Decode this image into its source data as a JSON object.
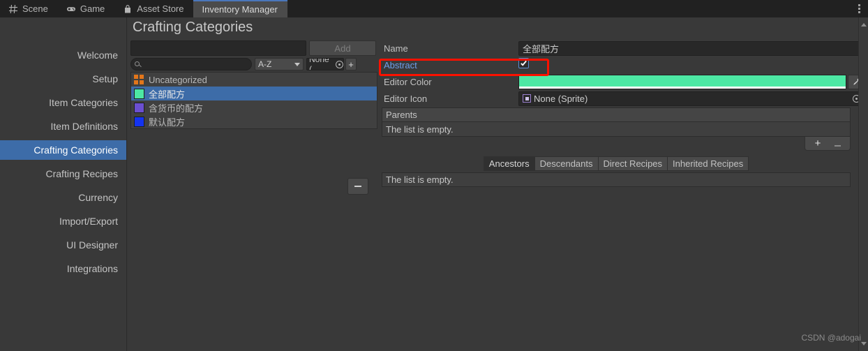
{
  "window": {
    "tabs": [
      {
        "label": "Scene",
        "icon": "grid-icon",
        "active": false
      },
      {
        "label": "Game",
        "icon": "gamepad-icon",
        "active": false
      },
      {
        "label": "Asset Store",
        "icon": "shopping-bag-icon",
        "active": false
      },
      {
        "label": "Inventory Manager",
        "icon": "none",
        "active": true
      }
    ],
    "menu_icon": "kebab-menu-icon"
  },
  "sidebar": {
    "items": [
      {
        "label": "Welcome",
        "active": false
      },
      {
        "label": "Setup",
        "active": false
      },
      {
        "label": "Item Categories",
        "active": false
      },
      {
        "label": "Item Definitions",
        "active": false
      },
      {
        "label": "Crafting Categories",
        "active": true
      },
      {
        "label": "Crafting Recipes",
        "active": false
      },
      {
        "label": "Currency",
        "active": false
      },
      {
        "label": "Import/Export",
        "active": false
      },
      {
        "label": "UI Designer",
        "active": false
      },
      {
        "label": "Integrations",
        "active": false
      }
    ]
  },
  "main": {
    "title": "Crafting Categories",
    "toolbar": {
      "new_name_value": "",
      "new_name_placeholder": "",
      "add_label": "Add",
      "search_value": "",
      "search_placeholder": "",
      "sort_value": "A-Z",
      "filter_value": "None (",
      "plus_label": "+"
    },
    "list": {
      "items": [
        {
          "label": "Uncategorized",
          "swatch": "#e2761b",
          "swatch_kind": "grid4",
          "selected": false
        },
        {
          "label": "全部配方",
          "swatch": "#4de8a4",
          "swatch_kind": "solid",
          "selected": true
        },
        {
          "label": "含货币的配方",
          "swatch": "#6b4fd0",
          "swatch_kind": "solid",
          "selected": false
        },
        {
          "label": "默认配方",
          "swatch": "#1433f0",
          "swatch_kind": "solid",
          "selected": false
        }
      ],
      "remove_label": "–"
    }
  },
  "inspector": {
    "fields": [
      {
        "label": "Name",
        "type": "text",
        "value": "全部配方"
      },
      {
        "label": "Abstract",
        "type": "checkbox",
        "value": "checked",
        "highlighted": true
      },
      {
        "label": "Editor Color",
        "type": "color",
        "value": "#4de8a4"
      },
      {
        "label": "Editor Icon",
        "type": "object",
        "value": "None (Sprite)"
      }
    ],
    "parents": {
      "header": "Parents",
      "empty_text": "The list is empty.",
      "add_label": "+",
      "remove_label": "–"
    },
    "relation_tabs": [
      {
        "label": "Ancestors",
        "active": true
      },
      {
        "label": "Descendants",
        "active": false
      },
      {
        "label": "Direct Recipes",
        "active": false
      },
      {
        "label": "Inherited Recipes",
        "active": false
      }
    ],
    "relation_empty_text": "The list is empty."
  },
  "annotation": {
    "color": "#fb1100",
    "target": "Abstract"
  },
  "watermark": "CSDN @adogai"
}
